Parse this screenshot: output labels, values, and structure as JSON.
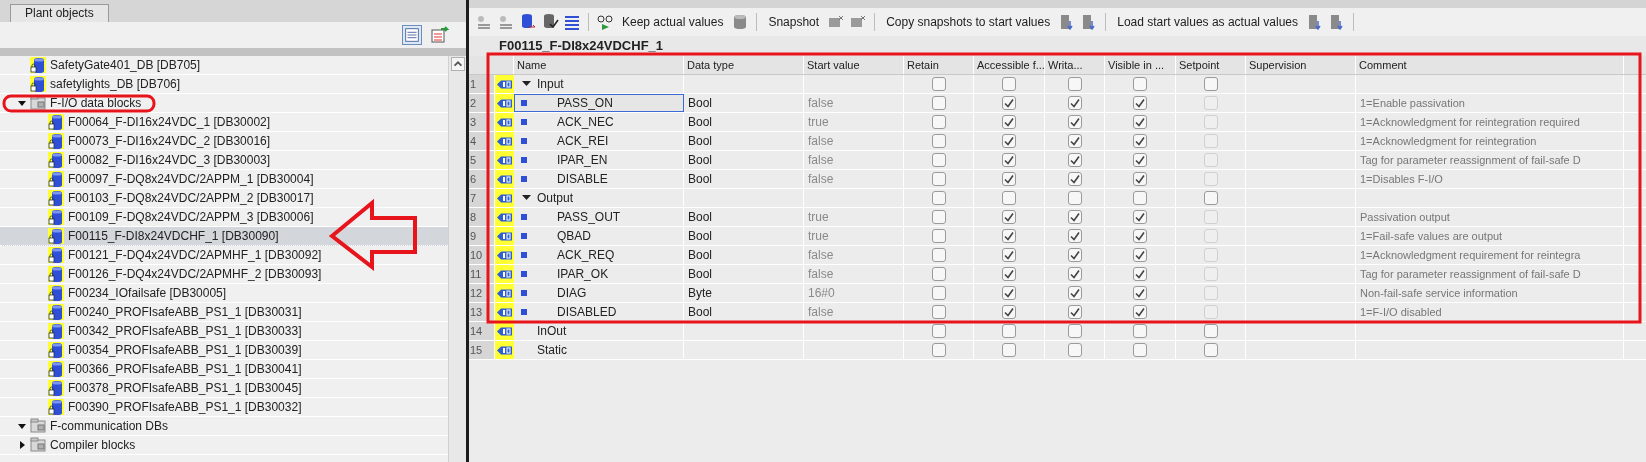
{
  "left_panel": {
    "tab": "Plant objects",
    "tree": [
      {
        "kind": "block",
        "label": "SafetyGate401_DB [DB705]",
        "selected": false
      },
      {
        "kind": "block",
        "label": "safetylights_DB [DB706]",
        "selected": false
      },
      {
        "kind": "folder",
        "label": "F-I/O data blocks",
        "expanded": true,
        "selected": false,
        "children": [
          {
            "kind": "block",
            "label": "F00064_F-DI16x24VDC_1 [DB30002]",
            "selected": false
          },
          {
            "kind": "block",
            "label": "F00073_F-DI16x24VDC_2 [DB30016]",
            "selected": false
          },
          {
            "kind": "block",
            "label": "F00082_F-DI16x24VDC_3 [DB30003]",
            "selected": false
          },
          {
            "kind": "block",
            "label": "F00097_F-DQ8x24VDC/2APPM_1 [DB30004]",
            "selected": false
          },
          {
            "kind": "block",
            "label": "F00103_F-DQ8x24VDC/2APPM_2 [DB30017]",
            "selected": false
          },
          {
            "kind": "block",
            "label": "F00109_F-DQ8x24VDC/2APPM_3 [DB30006]",
            "selected": false
          },
          {
            "kind": "block",
            "label": "F00115_F-DI8x24VDCHF_1 [DB30090]",
            "selected": true
          },
          {
            "kind": "block",
            "label": "F00121_F-DQ4x24VDC/2APMHF_1 [DB30092]",
            "selected": false
          },
          {
            "kind": "block",
            "label": "F00126_F-DQ4x24VDC/2APMHF_2 [DB30093]",
            "selected": false
          },
          {
            "kind": "block",
            "label": "F00234_IOfailsafe [DB30005]",
            "selected": false
          },
          {
            "kind": "block",
            "label": "F00240_PROFIsafeABB_PS1_1 [DB30031]",
            "selected": false
          },
          {
            "kind": "block",
            "label": "F00342_PROFIsafeABB_PS1_1 [DB30033]",
            "selected": false
          },
          {
            "kind": "block",
            "label": "F00354_PROFIsafeABB_PS1_1 [DB30039]",
            "selected": false
          },
          {
            "kind": "block",
            "label": "F00366_PROFIsafeABB_PS1_1 [DB30041]",
            "selected": false
          },
          {
            "kind": "block",
            "label": "F00378_PROFIsafeABB_PS1_1 [DB30045]",
            "selected": false
          },
          {
            "kind": "block",
            "label": "F00390_PROFIsafeABB_PS1_1 [DB30032]",
            "selected": false
          }
        ]
      },
      {
        "kind": "folder",
        "label": "F-communication DBs",
        "expanded": true,
        "selected": false
      },
      {
        "kind": "folder",
        "label": "Compiler blocks",
        "expanded": false,
        "selected": false
      }
    ]
  },
  "editor": {
    "toolbar": [
      {
        "label": "Keep actual values"
      },
      {
        "label": "Snapshot"
      },
      {
        "label": "Copy snapshots to start values"
      },
      {
        "label": "Load start values as actual values"
      }
    ],
    "title": "F00115_F-DI8x24VDCHF_1",
    "table": {
      "columns": [
        "Name",
        "Data type",
        "Start value",
        "Retain",
        "Accessible f...",
        "Writa...",
        "Visible in ...",
        "Setpoint",
        "Supervision",
        "Comment"
      ],
      "sections": [
        {
          "number": "1",
          "name": "Input",
          "expanded": true,
          "selected": false,
          "retain": false,
          "accessible": false,
          "writable": false,
          "visible": false,
          "setpoint": false,
          "children": [
            {
              "number": "2",
              "name": "PASS_ON",
              "data_type": "Bool",
              "start_value": "false",
              "selected": true,
              "retain": false,
              "accessible": true,
              "writable": true,
              "visible": true,
              "setpoint": false,
              "comment": "1=Enable passivation"
            },
            {
              "number": "3",
              "name": "ACK_NEC",
              "data_type": "Bool",
              "start_value": "true",
              "selected": false,
              "retain": false,
              "accessible": true,
              "writable": true,
              "visible": true,
              "setpoint": false,
              "comment": "1=Acknowledgment for reintegration required"
            },
            {
              "number": "4",
              "name": "ACK_REI",
              "data_type": "Bool",
              "start_value": "false",
              "selected": false,
              "retain": false,
              "accessible": true,
              "writable": true,
              "visible": true,
              "setpoint": false,
              "comment": "1=Acknowledgment for reintegration"
            },
            {
              "number": "5",
              "name": "IPAR_EN",
              "data_type": "Bool",
              "start_value": "false",
              "selected": false,
              "retain": false,
              "accessible": true,
              "writable": true,
              "visible": true,
              "setpoint": false,
              "comment": "Tag for parameter reassignment of fail-safe D"
            },
            {
              "number": "6",
              "name": "DISABLE",
              "data_type": "Bool",
              "start_value": "false",
              "selected": false,
              "retain": false,
              "accessible": true,
              "writable": true,
              "visible": true,
              "setpoint": false,
              "comment": "1=Disables F-I/O"
            }
          ]
        },
        {
          "number": "7",
          "name": "Output",
          "expanded": true,
          "selected": false,
          "retain": false,
          "accessible": false,
          "writable": false,
          "visible": false,
          "setpoint": false,
          "children": [
            {
              "number": "8",
              "name": "PASS_OUT",
              "data_type": "Bool",
              "start_value": "true",
              "selected": false,
              "retain": false,
              "accessible": true,
              "writable": true,
              "visible": true,
              "setpoint": false,
              "comment": "Passivation output"
            },
            {
              "number": "9",
              "name": "QBAD",
              "data_type": "Bool",
              "start_value": "true",
              "selected": false,
              "retain": false,
              "accessible": true,
              "writable": true,
              "visible": true,
              "setpoint": false,
              "comment": "1=Fail-safe values are output"
            },
            {
              "number": "10",
              "name": "ACK_REQ",
              "data_type": "Bool",
              "start_value": "false",
              "selected": false,
              "retain": false,
              "accessible": true,
              "writable": true,
              "visible": true,
              "setpoint": false,
              "comment": "1=Acknowledgment requirement for reintegra"
            },
            {
              "number": "11",
              "name": "IPAR_OK",
              "data_type": "Bool",
              "start_value": "false",
              "selected": false,
              "retain": false,
              "accessible": true,
              "writable": true,
              "visible": true,
              "setpoint": false,
              "comment": "Tag for parameter reassignment of fail-safe D"
            },
            {
              "number": "12",
              "name": "DIAG",
              "data_type": "Byte",
              "start_value": "16#0",
              "selected": false,
              "retain": false,
              "accessible": true,
              "writable": true,
              "visible": true,
              "setpoint": false,
              "comment": "Non-fail-safe service information"
            },
            {
              "number": "13",
              "name": "DISABLED",
              "data_type": "Bool",
              "start_value": "false",
              "selected": false,
              "retain": false,
              "accessible": true,
              "writable": true,
              "visible": true,
              "setpoint": false,
              "comment": "1=F-I/O disabled"
            }
          ]
        },
        {
          "number": "14",
          "name": "InOut",
          "selected": false,
          "retain": false,
          "accessible": false,
          "writable": false,
          "visible": false,
          "setpoint": false
        },
        {
          "number": "15",
          "name": "Static",
          "selected": false,
          "retain": false,
          "accessible": false,
          "writable": false,
          "visible": false,
          "setpoint": false
        }
      ]
    }
  }
}
